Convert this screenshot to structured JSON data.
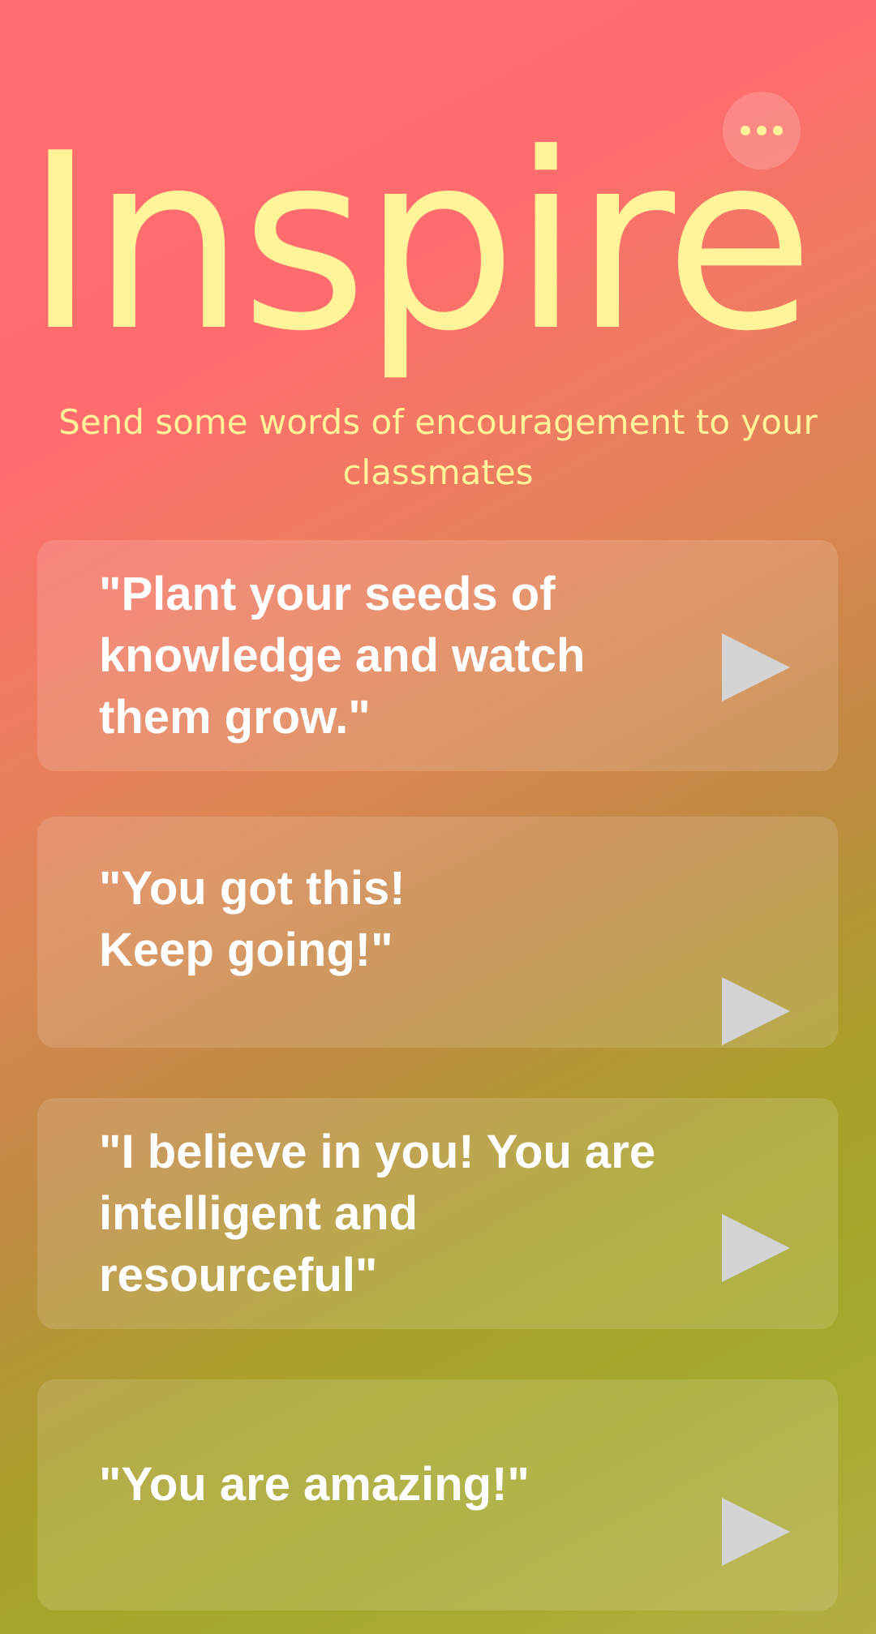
{
  "header": {
    "title": "Inspire",
    "subtitle": "Send some words of encouragement to your classmates",
    "menu_icon": "more-horizontal-icon",
    "accent_color": "#fff49a"
  },
  "quotes": [
    {
      "text": "\"Plant your seeds of knowledge and watch them grow.\"",
      "icon": "play-icon"
    },
    {
      "text": "\"You got this!\nKeep going!\"",
      "icon": "play-icon"
    },
    {
      "text": "\"I believe in you! You are intelligent and resourceful\"",
      "icon": "play-icon"
    },
    {
      "text": "\"You are amazing!\"",
      "icon": "play-icon"
    }
  ]
}
